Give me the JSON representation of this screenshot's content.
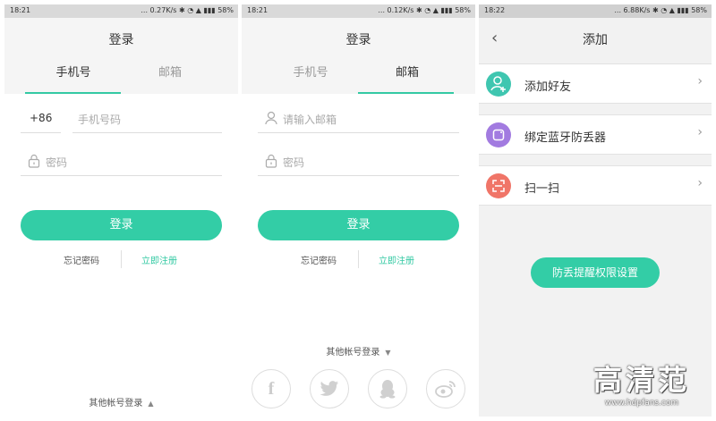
{
  "screen1": {
    "status": {
      "time": "18:21",
      "info": "... 0.27K/s ✱ ◔ ▲ ▮▮▮ 58%"
    },
    "title": "登录",
    "tabs": [
      {
        "label": "手机号"
      },
      {
        "label": "邮箱"
      }
    ],
    "phone_prefix": "+86",
    "phone_placeholder": "手机号码",
    "password_placeholder": "密码",
    "login_label": "登录",
    "forgot_label": "忘记密码",
    "register_label": "立即注册",
    "other_label": "其他帐号登录"
  },
  "screen2": {
    "status": {
      "time": "18:21",
      "info": "... 0.12K/s ✱ ◔ ▲ ▮▮▮ 58%"
    },
    "title": "登录",
    "tabs": [
      {
        "label": "手机号"
      },
      {
        "label": "邮箱"
      }
    ],
    "email_placeholder": "请输入邮箱",
    "password_placeholder": "密码",
    "login_label": "登录",
    "forgot_label": "忘记密码",
    "register_label": "立即注册",
    "other_label": "其他帐号登录",
    "social": [
      "facebook-icon",
      "twitter-icon",
      "qq-icon",
      "weibo-icon"
    ]
  },
  "screen3": {
    "status": {
      "time": "18:22",
      "info": "... 6.88K/s ✱ ◔ ▲ ▮▮▮ 58%"
    },
    "title": "添加",
    "items": [
      {
        "label": "添加好友",
        "color": "#3fc6b0"
      },
      {
        "label": "绑定蓝牙防丢器",
        "color": "#a27be0"
      },
      {
        "label": "扫一扫",
        "color": "#f07568"
      }
    ],
    "perm_button": "防丢提醒权限设置"
  },
  "watermark": {
    "big": "高清范",
    "small": "www.hdpfans.com"
  },
  "colors": {
    "accent": "#33cda6"
  }
}
